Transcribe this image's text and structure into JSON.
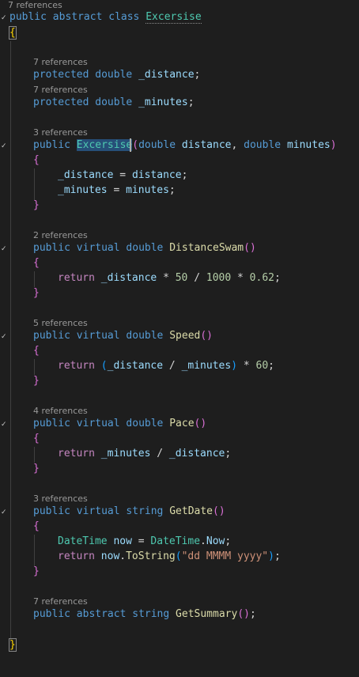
{
  "lenses": {
    "class": "7 references",
    "distance": "7 references",
    "minutes": "7 references",
    "ctor": "3 references",
    "distanceSwam": "2 references",
    "speed": "5 references",
    "pace": "4 references",
    "getDate": "3 references",
    "getSummary": "7 references"
  },
  "code": {
    "public": "public",
    "abstract": "abstract",
    "class": "class",
    "protected": "protected",
    "double": "double",
    "virtual": "virtual",
    "string": "string",
    "return": "return",
    "className": "Excersise",
    "field_distance": "_distance",
    "field_minutes": "_minutes",
    "param_distance": "distance",
    "param_minutes": "minutes",
    "m_distanceSwam": "DistanceSwam",
    "m_speed": "Speed",
    "m_pace": "Pace",
    "m_getDate": "GetDate",
    "m_getSummary": "GetSummary",
    "num_50": "50",
    "num_1000": "1000",
    "num_062": "0.62",
    "num_60": "60",
    "type_datetime": "DateTime",
    "var_now": "now",
    "prop_now": "Now",
    "m_tostring": "ToString",
    "fmt_string": "\"dd MMMM yyyy\""
  },
  "colors": {
    "background": "#1e1e1e",
    "keyword": "#569cd6",
    "type": "#4ec9b0",
    "method": "#dcdcaa",
    "identifier": "#9cdcfe",
    "number": "#b5cea8",
    "string": "#ce9178"
  }
}
